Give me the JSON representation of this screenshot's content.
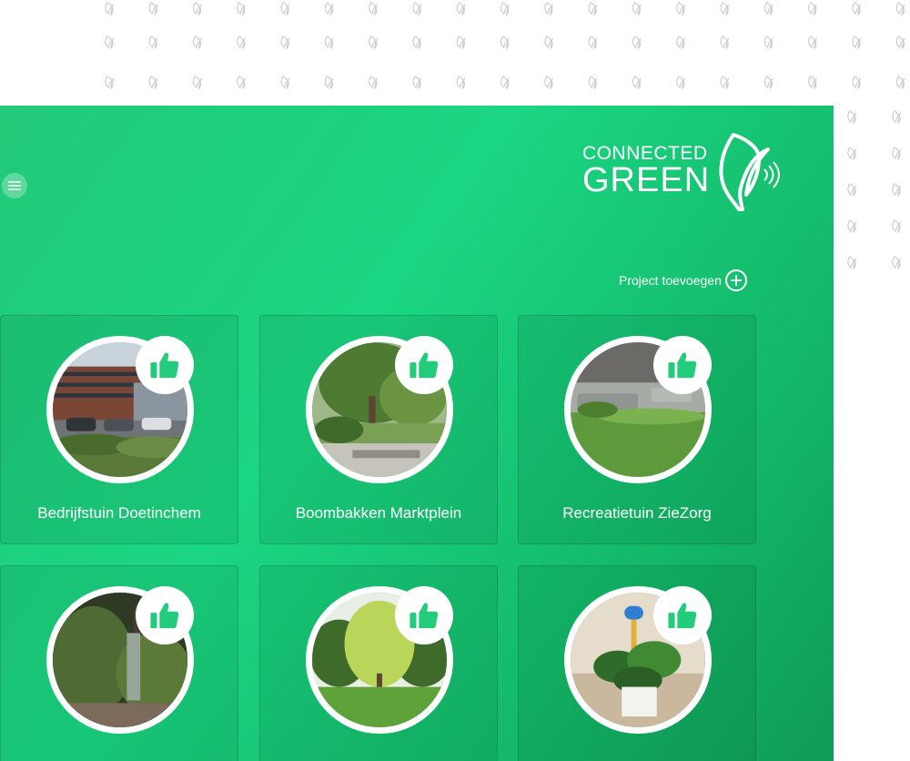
{
  "brand": {
    "line1": "CONNECTED",
    "line2": "GREEN"
  },
  "colors": {
    "accent": "#22cc7a",
    "leaf_pattern": "#c9cfcc",
    "text": "#ffffff"
  },
  "menu": {
    "icon": "hamburger-icon"
  },
  "actions": {
    "add_project_label": "Project toevoegen",
    "add_project_icon": "plus-circle-icon"
  },
  "projects": [
    {
      "title": "Bedrijfstuin Doetinchem",
      "status": "thumbs-up-icon"
    },
    {
      "title": "Boombakken Marktplein",
      "status": "thumbs-up-icon"
    },
    {
      "title": "Recreatietuin ZieZorg",
      "status": "thumbs-up-icon"
    },
    {
      "title": "",
      "status": "thumbs-up-icon"
    },
    {
      "title": "",
      "status": "thumbs-up-icon"
    },
    {
      "title": "",
      "status": "thumbs-up-icon"
    }
  ]
}
